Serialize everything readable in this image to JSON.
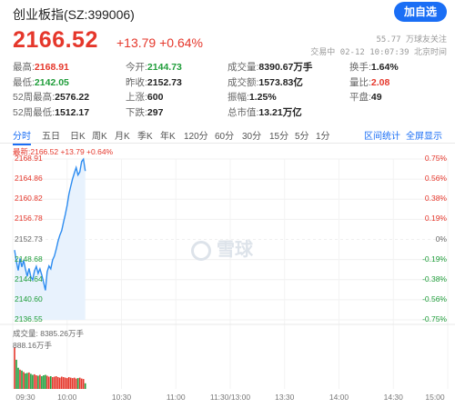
{
  "header": {
    "title": "创业板指(SZ:399006)",
    "add_button": "加自选"
  },
  "quote": {
    "price": "2166.52",
    "change": "+13.79 +0.64%",
    "followers": "55.77 万球友关注",
    "status": "交易中 02-12 10:07:39 北京时间"
  },
  "stats": [
    [
      {
        "label": "最高:",
        "value": "2168.91",
        "color": "red"
      },
      {
        "label": "今开:",
        "value": "2144.73",
        "color": "green"
      },
      {
        "label": "成交量:",
        "value": "8390.67万手",
        "color": ""
      },
      {
        "label": "换手:",
        "value": "1.64%",
        "color": ""
      }
    ],
    [
      {
        "label": "最低:",
        "value": "2142.05",
        "color": "green"
      },
      {
        "label": "昨收:",
        "value": "2152.73",
        "color": ""
      },
      {
        "label": "成交额:",
        "value": "1573.83亿",
        "color": ""
      },
      {
        "label": "量比:",
        "value": "2.08",
        "color": "red"
      }
    ],
    [
      {
        "label": "52周最高:",
        "value": "2576.22",
        "color": ""
      },
      {
        "label": "上涨:",
        "value": "600",
        "color": ""
      },
      {
        "label": "振幅:",
        "value": "1.25%",
        "color": ""
      },
      {
        "label": "平盘:",
        "value": "49",
        "color": ""
      }
    ],
    [
      {
        "label": "52周最低:",
        "value": "1512.17",
        "color": ""
      },
      {
        "label": "下跌:",
        "value": "297",
        "color": ""
      },
      {
        "label": "总市值:",
        "value": "13.21万亿",
        "color": ""
      }
    ]
  ],
  "tabs": [
    "分时",
    "五日",
    "日K",
    "周K",
    "月K",
    "季K",
    "年K",
    "120分",
    "60分",
    "30分",
    "15分",
    "5分",
    "1分"
  ],
  "active_tab": "分时",
  "tab_links": [
    "区间统计",
    "全屏显示"
  ],
  "chart_info": "最新:2166.52 +13.79 +0.64%",
  "volume_info": "成交量: 8385.26万手",
  "volume_max": "888.16万手",
  "watermark": "雪球",
  "chart_data": {
    "type": "line",
    "title": "",
    "y_left_ticks": [
      "2168.91",
      "2164.86",
      "2160.82",
      "2156.78",
      "2152.73",
      "2148.68",
      "2144.64",
      "2140.60",
      "2136.55"
    ],
    "y_right_ticks": [
      "0.75%",
      "0.56%",
      "0.38%",
      "0.19%",
      "0%",
      "-0.19%",
      "-0.38%",
      "-0.56%",
      "-0.75%"
    ],
    "x_ticks": [
      "09:30",
      "10:00",
      "10:30",
      "11:00",
      "11:30/13:00",
      "13:30",
      "14:00",
      "14:30",
      "15:00"
    ],
    "prev_close": 2152.73,
    "ylim": [
      2136.55,
      2168.91
    ],
    "series": [
      {
        "values": [
          2150.6,
          2148.3,
          2146.5,
          2148.9,
          2147.2,
          2148.5,
          2146.8,
          2145.3,
          2146.9,
          2145.2,
          2144.6,
          2146.4,
          2147.3,
          2145.9,
          2146.8,
          2145.6,
          2144.1,
          2142.5,
          2146.2,
          2147.4,
          2146.8,
          2148.6,
          2149.4,
          2150.8,
          2152.4,
          2153.6,
          2154.5,
          2156.2,
          2157.8,
          2159.6,
          2161.8,
          2163.4,
          2164.9,
          2166.1,
          2167.2,
          2165.7,
          2166.3,
          2168.4,
          2168.9,
          2166.5
        ]
      }
    ],
    "volume": [
      888,
      620,
      450,
      410,
      390,
      360,
      330,
      340,
      350,
      320,
      300,
      310,
      290,
      280,
      300,
      270,
      290,
      300,
      280,
      260,
      270,
      250,
      260,
      270,
      250,
      240,
      260,
      250,
      240,
      230,
      250,
      240,
      230,
      240,
      220,
      230,
      240,
      220,
      210,
      120
    ],
    "grid": true
  }
}
